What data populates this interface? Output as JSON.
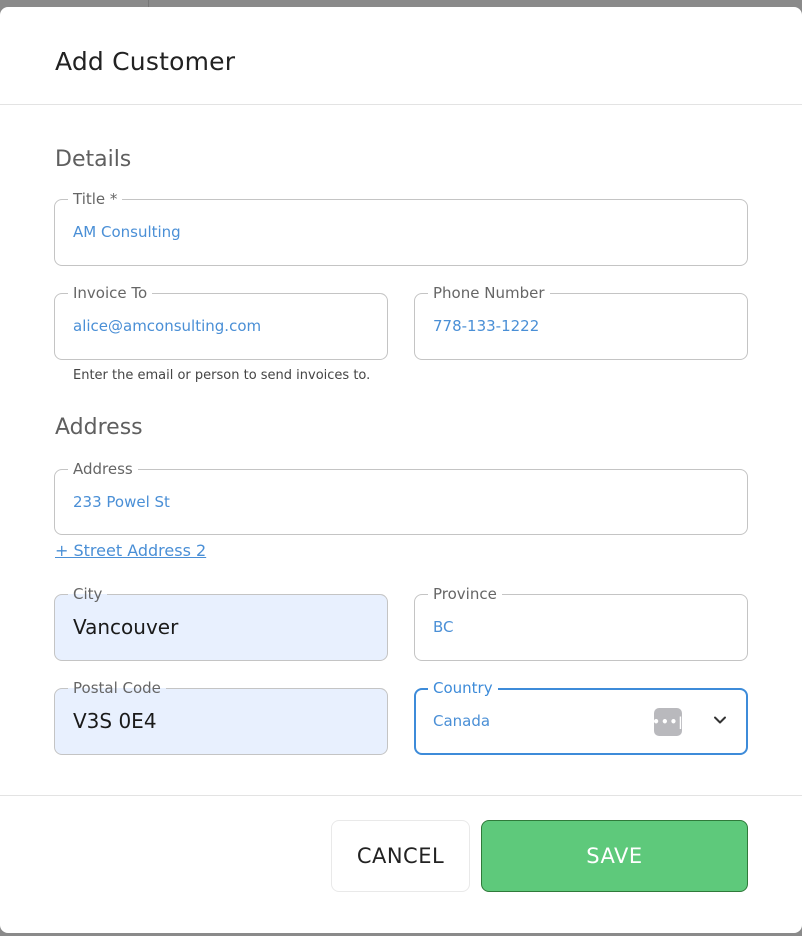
{
  "dialog": {
    "title": "Add Customer"
  },
  "sections": {
    "details": "Details",
    "address": "Address"
  },
  "fields": {
    "title": {
      "label": "Title *",
      "value": "AM Consulting"
    },
    "invoice_to": {
      "label": "Invoice To",
      "value": "alice@amconsulting.com",
      "helper": "Enter the email or person to send invoices to."
    },
    "phone": {
      "label": "Phone Number",
      "value": "778-133-1222"
    },
    "address": {
      "label": "Address",
      "value": "233 Powel St"
    },
    "city": {
      "label": "City",
      "value": "Vancouver"
    },
    "province": {
      "label": "Province",
      "value": "BC"
    },
    "postal_code": {
      "label": "Postal Code",
      "value": "V3S 0E4"
    },
    "country": {
      "label": "Country",
      "value": "Canada"
    }
  },
  "links": {
    "street_address_2": "+ Street Address 2"
  },
  "footer": {
    "cancel_label": "CANCEL",
    "save_label": "SAVE"
  },
  "icons": {
    "autofill": "password-manager-icon",
    "chevron": "chevron-down-icon"
  },
  "colors": {
    "accent": "#3d8bd9",
    "save_button": "#5ec97b",
    "autofill_bg": "#e8f0fe"
  }
}
